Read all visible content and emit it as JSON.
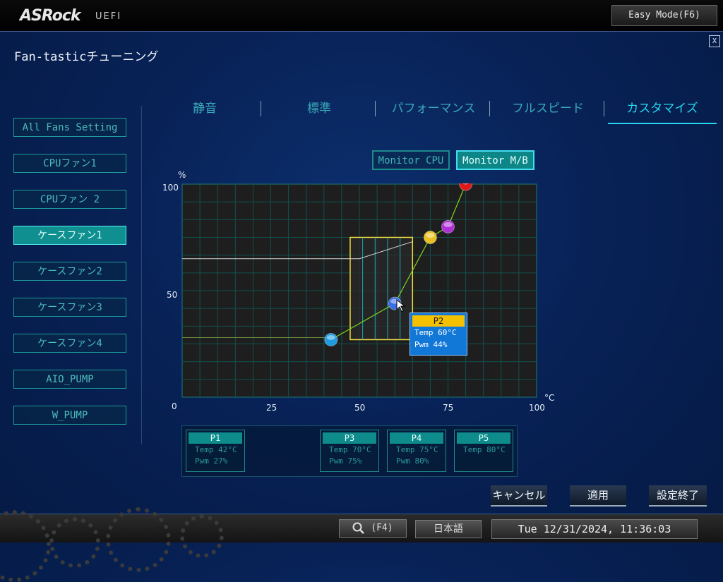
{
  "header": {
    "brand": "ASRock",
    "subtitle": "UEFI",
    "easy_mode_label": "Easy Mode(F6)",
    "close_label": "X"
  },
  "page": {
    "title": "Fan-tasticチューニング"
  },
  "sidebar": {
    "items": [
      {
        "label": "All Fans Setting",
        "active": false
      },
      {
        "label": "CPUファン1",
        "active": false
      },
      {
        "label": "CPUファン 2",
        "active": false
      },
      {
        "label": "ケースファン1",
        "active": true
      },
      {
        "label": "ケースファン2",
        "active": false
      },
      {
        "label": "ケースファン3",
        "active": false
      },
      {
        "label": "ケースファン4",
        "active": false
      },
      {
        "label": "AIO_PUMP",
        "active": false
      },
      {
        "label": "W_PUMP",
        "active": false
      }
    ]
  },
  "tabs": [
    {
      "label": "静音",
      "active": false
    },
    {
      "label": "標準",
      "active": false
    },
    {
      "label": "パフォーマンス",
      "active": false
    },
    {
      "label": "フルスピード",
      "active": false
    },
    {
      "label": "カスタマイズ",
      "active": true
    }
  ],
  "monitor": {
    "cpu_label": "Monitor CPU",
    "mb_label": "Monitor M/B",
    "selected": "Monitor M/B"
  },
  "chart_data": {
    "type": "line",
    "x_unit": "°C",
    "y_unit": "%",
    "xlim": [
      0,
      100
    ],
    "ylim": [
      0,
      100
    ],
    "x_ticks": [
      "0",
      "25",
      "50",
      "75",
      "100"
    ],
    "y_ticks": [
      "0",
      "50",
      "100"
    ],
    "grid": true,
    "fan_curve": [
      {
        "name": "P1",
        "temp": 42,
        "pwm": 27,
        "color": "#1e9ae0"
      },
      {
        "name": "P2",
        "temp": 60,
        "pwm": 44,
        "color": "#3a6ee8"
      },
      {
        "name": "P3",
        "temp": 70,
        "pwm": 75,
        "color": "#e8c020"
      },
      {
        "name": "P4",
        "temp": 75,
        "pwm": 80,
        "color": "#b030d8"
      },
      {
        "name": "P5",
        "temp": 80,
        "pwm": 100,
        "color": "#e01818"
      }
    ],
    "monitor_line": [
      [
        0,
        65
      ],
      [
        50,
        65
      ],
      [
        65,
        73
      ]
    ],
    "base_line": [
      [
        0,
        28
      ],
      [
        42,
        28
      ]
    ]
  },
  "tooltip": {
    "title": "P2",
    "temp_text": "Temp 60°C",
    "pwm_text": "Pwm  44%"
  },
  "points": [
    {
      "title": "P1",
      "temp_text": "Temp 42°C",
      "pwm_text": "Pwm  27%"
    },
    {
      "title": "P3",
      "temp_text": "Temp 70°C",
      "pwm_text": "Pwm  75%"
    },
    {
      "title": "P4",
      "temp_text": "Temp 75°C",
      "pwm_text": "Pwm  80%"
    },
    {
      "title": "P5",
      "temp_text": "Temp 80°C",
      "pwm_text": ""
    }
  ],
  "actions": {
    "cancel": "キャンセル",
    "apply": "適用",
    "finish": "設定終了"
  },
  "footer": {
    "search_label": "(F4)",
    "language": "日本語",
    "datetime": "Tue 12/31/2024, 11:36:03"
  },
  "colors": {
    "accent": "#25d6ee",
    "active_fill": "#0f8f8f",
    "curve": "#7dd820",
    "highlight_box": "#f0e040"
  }
}
